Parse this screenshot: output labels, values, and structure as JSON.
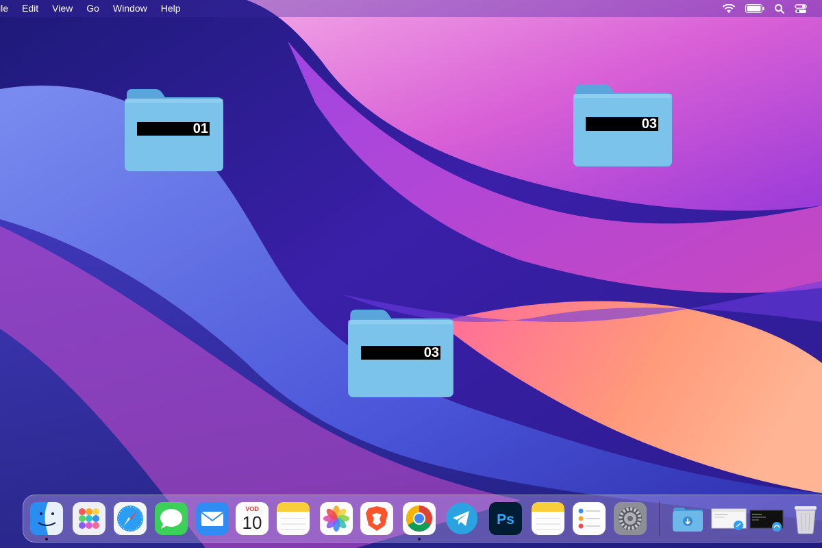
{
  "menubar": {
    "items": [
      "ile",
      "Edit",
      "View",
      "Go",
      "Window",
      "Help"
    ],
    "status_icons": [
      "wifi-icon",
      "battery-icon",
      "search-icon",
      "control-center-icon"
    ]
  },
  "desktop": {
    "folders": [
      {
        "label": "01"
      },
      {
        "label": "03"
      },
      {
        "label": "03"
      }
    ]
  },
  "dock": {
    "apps": [
      {
        "name": "finder",
        "running": true
      },
      {
        "name": "launchpad"
      },
      {
        "name": "safari"
      },
      {
        "name": "messages"
      },
      {
        "name": "mail"
      },
      {
        "name": "calendar",
        "month": "VOD",
        "day": "10"
      },
      {
        "name": "notes"
      },
      {
        "name": "photos"
      },
      {
        "name": "brave"
      },
      {
        "name": "chrome",
        "running": true
      },
      {
        "name": "telegram"
      },
      {
        "name": "photoshop",
        "text": "Ps"
      },
      {
        "name": "notes-2"
      },
      {
        "name": "reminders"
      },
      {
        "name": "system-preferences"
      }
    ],
    "right_items": [
      "downloads-folder-icon",
      "preview-window-thumbnail",
      "terminal-window-thumbnail",
      "trash-icon"
    ]
  },
  "colors": {
    "folder_body": "#7cc3ec",
    "folder_tab": "#5aa6dc",
    "label_bg": "#000000",
    "label_text": "#ffffff"
  }
}
